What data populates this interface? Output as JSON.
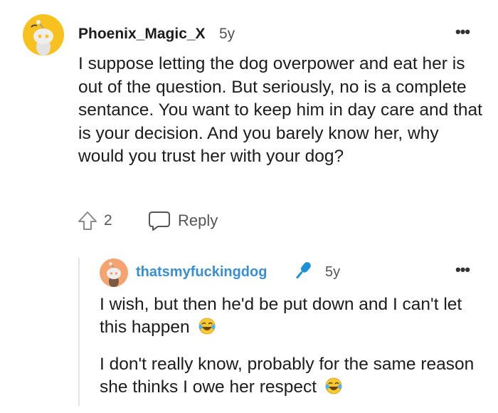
{
  "comment": {
    "author": "Phoenix_Magic_X",
    "age": "5y",
    "more": "•••",
    "body": "I suppose letting the dog overpower and eat her is out of the question. But seriously, no is a complete sentance. You want to keep him in day care and that is your decision. And you barely know her, why would you trust her with your dog?",
    "votes": "2",
    "reply_label": "Reply",
    "avatar_color": "#f7c21f",
    "upvote_icon": "upvote-arrow",
    "reply_icon": "speech-bubble"
  },
  "reply": {
    "author": "thatsmyfuckingdog",
    "author_color": "#3a8fd0",
    "flair_icon": "microphone",
    "age": "5y",
    "more": "•••",
    "paragraph1": "I wish, but then he'd be put down and I can't let this happen",
    "paragraph2": "I don't really know, probably for the same reason she thinks I owe her respect",
    "emoji": "face-with-tears-of-joy",
    "avatar_color": "#f4a371"
  }
}
